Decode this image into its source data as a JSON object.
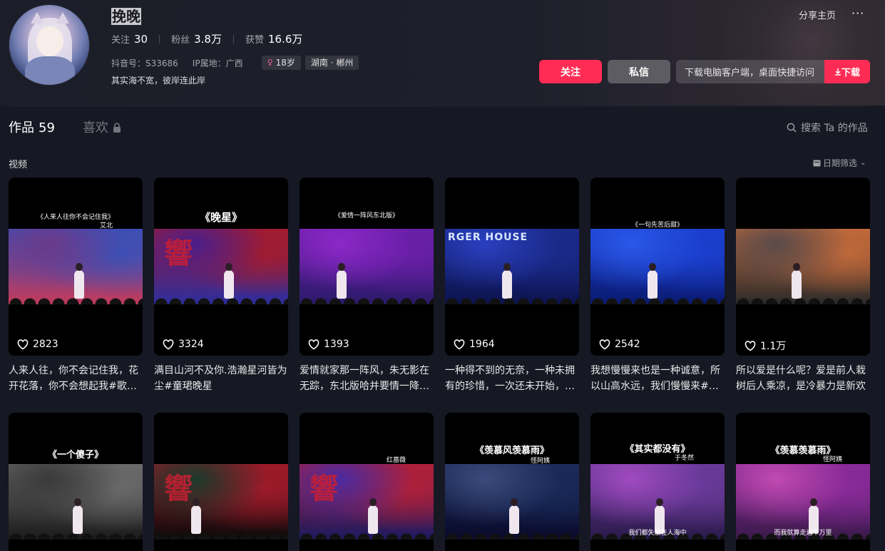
{
  "profile": {
    "nickname": "挽晚",
    "stats": [
      {
        "label": "关注",
        "value": "30"
      },
      {
        "label": "粉丝",
        "value": "3.8万"
      },
      {
        "label": "获赞",
        "value": "16.6万"
      }
    ],
    "douyin_id": "抖音号：S33686",
    "ip_location": "IP属地：广西",
    "age_tag": "18岁",
    "region_tag": "湖南 · 郴州",
    "bio": "其实海不宽，彼岸连此岸"
  },
  "header": {
    "share_label": "分享主页",
    "more_label": "···",
    "follow_label": "关注",
    "message_label": "私信",
    "download_text": "下载电脑客户端，桌面快捷访问",
    "download_label": "下载"
  },
  "tabs": {
    "works_label": "作品",
    "works_count": "59",
    "likes_label": "喜欢",
    "search_label": "搜索 Ta 的作品"
  },
  "section": {
    "title": "视频",
    "date_filter": "日期筛选"
  },
  "videos": [
    {
      "caption": "《人来人往你不会记住我》",
      "artist": "艾北",
      "likes": "2823",
      "desc": "人来人往，你不会记住我，花开花落，你不会想起我#歌手挽晚",
      "colors": [
        "#3b4fb6",
        "#6a3a8a",
        "#c43a5a"
      ]
    },
    {
      "caption": "《晚星》",
      "artist": "",
      "likes": "3324",
      "desc": "满目山河不及你.浩瀚星河皆为尘#童珺晚星",
      "colors": [
        "#a31b2e",
        "#4b1e8a",
        "#2a2ea0"
      ]
    },
    {
      "caption": "《爱情一阵风东北版》",
      "artist": "",
      "likes": "1393",
      "desc": "爱情就家那一阵风，朱无影在无踪，东北版哈并要情一降风#挽晚",
      "colors": [
        "#6a1fa8",
        "#8c28c8",
        "#2b1a6a"
      ]
    },
    {
      "caption": "",
      "artist": "",
      "likes": "1964",
      "desc": "一种得不到的无奈，一种未拥有的珍惜，一次还未开始，就已经结束",
      "colors": [
        "#1a2a8a",
        "#2a3fc0",
        "#0d1450"
      ]
    },
    {
      "caption": "《一句先苦后甜》",
      "artist": "",
      "likes": "2542",
      "desc": "我想慢慢来也是一种诚意，所以山高水远，我们慢慢来#挽晚",
      "colors": [
        "#1b3fd0",
        "#2a58e8",
        "#0a1a70"
      ]
    },
    {
      "caption": "",
      "artist": "",
      "likes": "1.1万",
      "desc": "所以爱是什么呢？爱是前人栽树后人乘凉，是冷暴力是新欢",
      "colors": [
        "#c0693a",
        "#5a4a4a",
        "#2a2a2a"
      ]
    },
    {
      "caption": "《一个傻子》",
      "artist": "",
      "likes": "",
      "desc": "",
      "colors": [
        "#6a6a6a",
        "#3a3a3a",
        "#1a1a1a"
      ]
    },
    {
      "caption": "",
      "artist": "",
      "likes": "",
      "desc": "",
      "colors": [
        "#a01a2a",
        "#1a3a2a",
        "#0a0a0a"
      ]
    },
    {
      "caption": "",
      "artist": "红蔷薇",
      "likes": "",
      "desc": "",
      "colors": [
        "#b0203a",
        "#4a2aa0",
        "#1a1a60"
      ]
    },
    {
      "caption": "《羡慕风羡慕雨》",
      "artist": "怪阿姨",
      "likes": "",
      "desc": "",
      "colors": [
        "#1a2a5a",
        "#3a4a7a",
        "#0a0a2a"
      ]
    },
    {
      "caption": "《其实都没有》",
      "artist": "于冬然",
      "likes": "",
      "desc": "",
      "colors": [
        "#6a3a9a",
        "#a04ac0",
        "#2a1a4a"
      ]
    },
    {
      "caption": "《羡慕羡慕雨》",
      "artist": "怪阿姨",
      "likes": "",
      "desc": "",
      "colors": [
        "#8a2a9a",
        "#c04ab0",
        "#3a1a4a"
      ]
    }
  ],
  "video_overlays": {
    "v2_sign": "響",
    "v4_sign": "RGER HOUSE",
    "v8_sign": "響",
    "v9_sign": "響",
    "v11_subtitle": "我们都失散在人海中",
    "v12_subtitle": "而我就算走遍千万里"
  },
  "colors": {
    "accent": "#fe2c55",
    "background": "#161823"
  }
}
